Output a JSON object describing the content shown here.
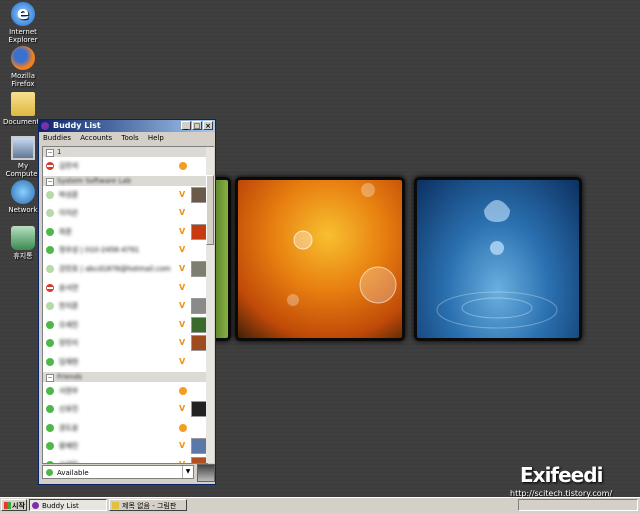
{
  "desktop": {
    "icons": [
      {
        "label": "Internet Explorer",
        "icon": "ie-icon"
      },
      {
        "label": "Mozilla Firefox",
        "icon": "firefox-icon"
      },
      {
        "label": "Documents",
        "icon": "folder-icon"
      },
      {
        "label": "My Computer",
        "icon": "computer-icon"
      },
      {
        "label": "Network",
        "icon": "network-icon"
      },
      {
        "label": "휴지통",
        "icon": "recycle-bin-icon"
      }
    ]
  },
  "window": {
    "title": "Buddy List",
    "menu": [
      "Buddies",
      "Accounts",
      "Tools",
      "Help"
    ],
    "groups": [
      {
        "name": "1",
        "buddies": [
          {
            "name": "김민석",
            "status": "busy",
            "client": "msn",
            "avatar": ""
          }
        ]
      },
      {
        "name": "System Software Lab",
        "buddies": [
          {
            "name": "박성훈",
            "status": "away",
            "client": "v",
            "avatar": "#6b5a4a"
          },
          {
            "name": "이지은",
            "status": "away",
            "client": "v",
            "avatar": ""
          },
          {
            "name": "최준",
            "status": "available",
            "client": "v",
            "avatar": "#c83a10"
          },
          {
            "name": "정우성 | 010-2456-4791",
            "status": "available",
            "client": "v",
            "avatar": ""
          },
          {
            "name": "강민호 | abcd1876@hotmail.com",
            "status": "away",
            "client": "v",
            "avatar": "#7d7d70"
          },
          {
            "name": "윤서연",
            "status": "busy",
            "client": "v",
            "avatar": ""
          },
          {
            "name": "한지훈",
            "status": "away",
            "client": "v",
            "avatar": "#8a8a8a"
          },
          {
            "name": "오세진",
            "status": "available",
            "client": "v",
            "avatar": "#3a6b2a"
          },
          {
            "name": "장민지",
            "status": "available",
            "client": "v",
            "avatar": "#a04a20"
          },
          {
            "name": "임재현",
            "status": "available",
            "client": "v",
            "avatar": ""
          }
        ]
      },
      {
        "name": "Friends",
        "buddies": [
          {
            "name": "서현우",
            "status": "available",
            "client": "msn",
            "avatar": ""
          },
          {
            "name": "신유진",
            "status": "available",
            "client": "v",
            "avatar": "#222222"
          },
          {
            "name": "권도윤",
            "status": "available",
            "client": "msn",
            "avatar": ""
          },
          {
            "name": "황예린",
            "status": "available",
            "client": "v",
            "avatar": "#5a78a8"
          },
          {
            "name": "송태민",
            "status": "available",
            "client": "v",
            "avatar": "#b05020"
          }
        ]
      }
    ],
    "status": "Available"
  },
  "taskbar": {
    "start": "시작",
    "tasks": [
      "Buddy List",
      "제목 없음 - 그림판"
    ]
  },
  "watermark": {
    "logo": "Exifeedi",
    "url": "http://scitech.tistory.com/"
  },
  "colors": {
    "available": "#4db848",
    "away": "#b8d8a8",
    "busy": "#d83a2e"
  }
}
